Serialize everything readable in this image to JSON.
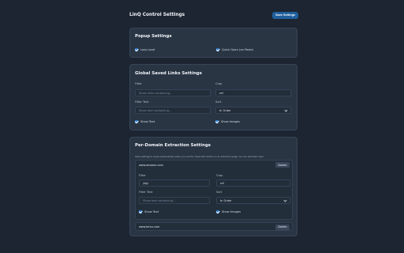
{
  "header": {
    "title": "LinQ Control Settings",
    "save_label": "Save Settings"
  },
  "popup": {
    "title": "Popup Settings",
    "options": [
      {
        "label": "Lazy Load",
        "checked": true
      },
      {
        "label": "Quick Open (on Paste)",
        "checked": true
      }
    ]
  },
  "global": {
    "title": "Global Saved Links Settings",
    "filter_label": "Filter",
    "filter_placeholder": "Show links containing...",
    "crop_label": "Crop",
    "crop_value": "ref",
    "filter_text_label": "Filter Text",
    "filter_text_placeholder": "Show text containing...",
    "sort_label": "Sort",
    "sort_value": "In Order",
    "show_text": "Show Text",
    "show_images": "Show Images"
  },
  "per_domain": {
    "title": "Per-Domain Extraction Settings",
    "description": "Store settings to reuse automatically when you use the \"Save Tab\" button on an extraction page. You can edit them here.",
    "domains": [
      {
        "name": "www.amazon.com",
        "delete_label": "Delete",
        "filter_label": "Filter",
        "filter_value": "/dp/",
        "crop_label": "Crop",
        "crop_value": "ref",
        "filter_text_label": "Filter Text",
        "filter_text_placeholder": "Show text containing...",
        "sort_label": "Sort",
        "sort_value": "In Order",
        "show_text": "Show Text",
        "show_images": "Show Images"
      },
      {
        "name": "www.temu.com",
        "delete_label": "Delete"
      }
    ]
  },
  "colors": {
    "background": "#1c2531",
    "card": "#2a3544",
    "accent": "#2b7dd1",
    "save_button": "#1f5f9d"
  }
}
